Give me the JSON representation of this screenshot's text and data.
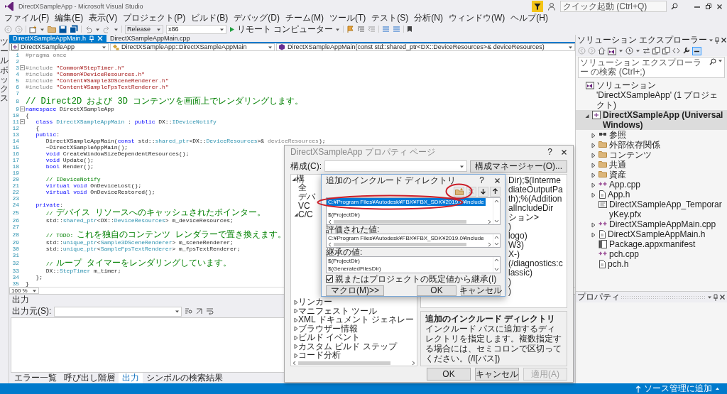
{
  "window": {
    "title": "DirectXSampleApp - Microsoft Visual Studio",
    "quick_launch": {
      "placeholder": "クイック起動 (Ctrl+Q)"
    }
  },
  "menu": [
    "ファイル(F)",
    "編集(E)",
    "表示(V)",
    "プロジェクト(P)",
    "ビルド(B)",
    "デバッグ(D)",
    "チーム(M)",
    "ツール(T)",
    "テスト(S)",
    "分析(N)",
    "ウィンドウ(W)",
    "ヘルプ(H)"
  ],
  "toolbar": {
    "configuration": "Release",
    "platform": "x86",
    "run_target": "リモート コンピューター"
  },
  "toolbox_tab": "ツールボックス",
  "editor": {
    "tabs": [
      {
        "label": "DirectXSampleAppMain.h",
        "selected": true
      },
      {
        "label": "DirectXSampleAppMain.cpp",
        "selected": false
      }
    ],
    "nav": [
      "DirectXSampleApp",
      "DirectXSampleApp::DirectXSampleAppMain",
      "DirectXSampleAppMain(const std::shared_ptr<DX::DeviceResources>& deviceResources)"
    ],
    "lines": [
      {
        "n": "1",
        "fold": false,
        "code": [
          {
            "kind": "pp",
            "text": "#pragma once"
          }
        ]
      },
      {
        "n": "2",
        "fold": false
      },
      {
        "n": "3",
        "fold": true,
        "code": [
          {
            "kind": "pp",
            "text": "#include "
          },
          {
            "kind": "str",
            "text": "\"Common¥StepTimer.h\""
          }
        ]
      },
      {
        "n": "4",
        "fold": false,
        "code": [
          {
            "kind": "pp",
            "text": "#include "
          },
          {
            "kind": "str",
            "text": "\"Common¥DeviceResources.h\""
          }
        ]
      },
      {
        "n": "5",
        "fold": false,
        "code": [
          {
            "kind": "pp",
            "text": "#include "
          },
          {
            "kind": "str",
            "text": "\"Content¥Sample3DSceneRenderer.h\""
          }
        ]
      },
      {
        "n": "6",
        "fold": false,
        "code": [
          {
            "kind": "pp",
            "text": "#include "
          },
          {
            "kind": "str",
            "text": "\"Content¥SampleFpsTextRenderer.h\""
          }
        ]
      },
      {
        "n": "7",
        "fold": false
      },
      {
        "n": "8",
        "fold": false,
        "code": [
          {
            "kind": "jp",
            "text": "// Direct2D および 3D コンテンツを画面上でレンダリングします。"
          }
        ]
      },
      {
        "n": "9",
        "fold": true,
        "code": [
          {
            "kind": "kw",
            "text": "namespace"
          },
          {
            "kind": "p",
            "text": " DirectXSampleApp"
          }
        ]
      },
      {
        "n": "10",
        "fold": false,
        "code": [
          {
            "kind": "p",
            "text": "{"
          }
        ]
      },
      {
        "n": "11",
        "fold": true,
        "code": [
          {
            "kind": "kw",
            "text": "   class"
          },
          {
            "kind": "ty",
            "text": " DirectXSampleAppMain"
          },
          {
            "kind": "p",
            "text": " : "
          },
          {
            "kind": "kw",
            "text": "public"
          },
          {
            "kind": "p",
            "text": " DX::"
          },
          {
            "kind": "ty",
            "text": "IDeviceNotify"
          }
        ]
      },
      {
        "n": "12",
        "fold": false,
        "code": [
          {
            "kind": "p",
            "text": "   {"
          }
        ]
      },
      {
        "n": "13",
        "fold": false,
        "code": [
          {
            "kind": "kw",
            "text": "   public"
          },
          {
            "kind": "p",
            "text": ":"
          }
        ]
      },
      {
        "n": "14",
        "fold": false,
        "code": [
          {
            "kind": "p",
            "text": "      DirectXSampleAppMain("
          },
          {
            "kind": "kw",
            "text": "const"
          },
          {
            "kind": "p",
            "text": " std::"
          },
          {
            "kind": "ty",
            "text": "shared_ptr"
          },
          {
            "kind": "p",
            "text": "<DX::"
          },
          {
            "kind": "ty",
            "text": "DeviceResources"
          },
          {
            "kind": "p",
            "text": ">& "
          },
          {
            "kind": "pa",
            "text": "deviceResources"
          },
          {
            "kind": "p",
            "text": ");"
          }
        ]
      },
      {
        "n": "15",
        "fold": false,
        "code": [
          {
            "kind": "p",
            "text": "      ~DirectXSampleAppMain();"
          }
        ]
      },
      {
        "n": "16",
        "fold": false,
        "code": [
          {
            "kind": "kw",
            "text": "      void"
          },
          {
            "kind": "p",
            "text": " CreateWindowSizeDependentResources();"
          }
        ]
      },
      {
        "n": "17",
        "fold": false,
        "code": [
          {
            "kind": "kw",
            "text": "      void"
          },
          {
            "kind": "p",
            "text": " Update();"
          }
        ]
      },
      {
        "n": "18",
        "fold": false,
        "code": [
          {
            "kind": "kw",
            "text": "      bool"
          },
          {
            "kind": "p",
            "text": " Render();"
          }
        ]
      },
      {
        "n": "19",
        "fold": false
      },
      {
        "n": "20",
        "fold": false,
        "code": [
          {
            "kind": "cm",
            "text": "      // IDeviceNotify"
          }
        ]
      },
      {
        "n": "21",
        "fold": false,
        "code": [
          {
            "kind": "kw",
            "text": "      virtual void"
          },
          {
            "kind": "p",
            "text": " OnDeviceLost();"
          }
        ]
      },
      {
        "n": "22",
        "fold": false,
        "code": [
          {
            "kind": "kw",
            "text": "      virtual void"
          },
          {
            "kind": "p",
            "text": " OnDeviceRestored();"
          }
        ]
      },
      {
        "n": "23",
        "fold": false
      },
      {
        "n": "24",
        "fold": false,
        "code": [
          {
            "kind": "kw",
            "text": "   private"
          },
          {
            "kind": "p",
            "text": ":"
          }
        ]
      },
      {
        "n": "25",
        "fold": false,
        "code": [
          {
            "kind": "cm",
            "text": "      // "
          },
          {
            "kind": "jp",
            "text": "デバイス リソースへのキャッシュされたポインター。"
          }
        ]
      },
      {
        "n": "26",
        "fold": false,
        "code": [
          {
            "kind": "p",
            "text": "      std::"
          },
          {
            "kind": "ty",
            "text": "shared_ptr"
          },
          {
            "kind": "p",
            "text": "<DX::"
          },
          {
            "kind": "ty",
            "text": "DeviceResources"
          },
          {
            "kind": "p",
            "text": "> m_deviceResources;"
          }
        ]
      },
      {
        "n": "27",
        "fold": false
      },
      {
        "n": "28",
        "fold": false,
        "code": [
          {
            "kind": "cm",
            "text": "      // TODO: "
          },
          {
            "kind": "jp",
            "text": "これを独自のコンテンツ レンダラーで置き換えます。"
          }
        ]
      },
      {
        "n": "29",
        "fold": false,
        "code": [
          {
            "kind": "p",
            "text": "      std::"
          },
          {
            "kind": "ty",
            "text": "unique_ptr"
          },
          {
            "kind": "p",
            "text": "<"
          },
          {
            "kind": "ty",
            "text": "Sample3DSceneRenderer"
          },
          {
            "kind": "p",
            "text": "> m_sceneRenderer;"
          }
        ]
      },
      {
        "n": "30",
        "fold": false,
        "code": [
          {
            "kind": "p",
            "text": "      std::"
          },
          {
            "kind": "ty",
            "text": "unique_ptr"
          },
          {
            "kind": "p",
            "text": "<"
          },
          {
            "kind": "ty",
            "text": "SampleFpsTextRenderer"
          },
          {
            "kind": "p",
            "text": "> m_fpsTextRenderer;"
          }
        ]
      },
      {
        "n": "31",
        "fold": false
      },
      {
        "n": "32",
        "fold": false,
        "code": [
          {
            "kind": "cm",
            "text": "      // "
          },
          {
            "kind": "jp",
            "text": "ループ タイマーをレンダリングしています。"
          }
        ]
      },
      {
        "n": "33",
        "fold": false,
        "code": [
          {
            "kind": "p",
            "text": "      DX::"
          },
          {
            "kind": "ty",
            "text": "StepTimer"
          },
          {
            "kind": "p",
            "text": " m_timer;"
          }
        ]
      },
      {
        "n": "34",
        "fold": false,
        "code": [
          {
            "kind": "p",
            "text": "   };"
          }
        ]
      },
      {
        "n": "35",
        "fold": false,
        "code": [
          {
            "kind": "p",
            "text": "}"
          }
        ]
      }
    ],
    "zoom": "100 %"
  },
  "output": {
    "title": "出力",
    "source_label": "出力元(S):"
  },
  "bottom_tabs": [
    {
      "label": "エラー一覧",
      "selected": false
    },
    {
      "label": "呼び出し階層",
      "selected": false
    },
    {
      "label": "出力",
      "selected": true
    },
    {
      "label": "シンボルの検索結果",
      "selected": false
    }
  ],
  "solution_explorer": {
    "title": "ソリューション エクスプローラー",
    "search": {
      "placeholder": "ソリューション エクスプローラー の検索 (Ctrl+;)"
    },
    "tree": [
      {
        "label": "ソリューション 'DirectXSampleApp' (1 プロジェクト)",
        "kind": "solution",
        "expandable": false,
        "selected": false,
        "children": [
          {
            "label": "DirectXSampleApp (Universal Windows)",
            "kind": "project",
            "expandable": true,
            "expanded": true,
            "selected": true,
            "children": [
              {
                "label": "参照",
                "kind": "references",
                "expandable": true,
                "expanded": false,
                "selected": false
              },
              {
                "label": "外部依存関係",
                "kind": "folder",
                "expandable": true,
                "expanded": false,
                "selected": false
              },
              {
                "label": "コンテンツ",
                "kind": "folder",
                "expandable": true,
                "expanded": false,
                "selected": false
              },
              {
                "label": "共通",
                "kind": "folder",
                "expandable": true,
                "expanded": false,
                "selected": false
              },
              {
                "label": "資産",
                "kind": "folder",
                "expandable": true,
                "expanded": false,
                "selected": false
              },
              {
                "label": "App.cpp",
                "kind": "cpp",
                "expandable": true,
                "expanded": false,
                "selected": false
              },
              {
                "label": "App.h",
                "kind": "header",
                "expandable": true,
                "expanded": false,
                "selected": false
              },
              {
                "label": "DirectXSampleApp_TemporaryKey.pfx",
                "kind": "key",
                "expandable": false,
                "selected": false
              },
              {
                "label": "DirectXSampleAppMain.cpp",
                "kind": "cpp",
                "expandable": true,
                "expanded": false,
                "selected": false
              },
              {
                "label": "DirectXSampleAppMain.h",
                "kind": "header",
                "expandable": true,
                "expanded": false,
                "selected": false
              },
              {
                "label": "Package.appxmanifest",
                "kind": "manifest",
                "expandable": false,
                "selected": false
              },
              {
                "label": "pch.cpp",
                "kind": "cpp",
                "expandable": false,
                "selected": false
              },
              {
                "label": "pch.h",
                "kind": "header",
                "expandable": false,
                "selected": false
              }
            ]
          }
        ]
      }
    ]
  },
  "properties": {
    "title": "プロパティ"
  },
  "property_pages": {
    "title": "DirectXSampleApp プロパティ ページ",
    "help": "?",
    "config_label": "構成(C):",
    "config_manager": "構成マネージャー(O)...",
    "tree_top": [
      {
        "text": "構",
        "expandable": true,
        "expanded": true,
        "children": [
          {
            "text": "全",
            "expandable": false
          },
          {
            "text": "デバ",
            "expandable": false
          },
          {
            "text": "VC",
            "expandable": false
          },
          {
            "text": "C/C",
            "expandable": true,
            "expanded": true
          }
        ]
      }
    ],
    "tree_bottom": [
      {
        "text": "リンカー",
        "expandable": true,
        "expanded": false
      },
      {
        "text": "マニフェスト ツール",
        "expandable": true,
        "expanded": false
      },
      {
        "text": "XML ドキュメント ジェネレー",
        "expandable": true,
        "expanded": false
      },
      {
        "text": "ブラウザー情報",
        "expandable": true,
        "expanded": false
      },
      {
        "text": "ビルド イベント",
        "expandable": true,
        "expanded": false
      },
      {
        "text": "カスタム ビルド ステップ",
        "expandable": true,
        "expanded": false
      },
      {
        "text": "コード分析",
        "expandable": true,
        "expanded": false
      }
    ],
    "values": [
      {
        "text": "Dir);$(IntermediateOutputPath);%(AdditionalIncludeDir"
      },
      {
        "text": "ション>"
      },
      {
        "text": ")"
      },
      {
        "text": "logo)"
      },
      {
        "text": "W3)"
      },
      {
        "text": "X-)"
      },
      {
        "text": "(/diagnostics:classic)"
      },
      {
        "text": ")"
      },
      {
        "text": ")"
      }
    ],
    "description": {
      "title": "追加のインクルード ディレクトリ",
      "text": "インクルード パスに追加するディレクトリを指定します。複数指定する場合には、セミコロンで区切ってください。(/I[パス])"
    },
    "buttons": [
      {
        "label": "OK",
        "disabled": false
      },
      {
        "label": "キャンセル",
        "disabled": false
      },
      {
        "label": "適用(A)",
        "disabled": true
      }
    ]
  },
  "include_dialog": {
    "title": "追加のインクルード ディレクトリ",
    "help": "?",
    "entries": [
      {
        "text": "C:¥Program Files¥Autodesk¥FBX¥FBX_SDK¥2019.0¥include",
        "selected": true
      },
      {
        "text": "$(ProjectDir)",
        "selected": false
      }
    ],
    "evaluated_label": "評価された値:",
    "evaluated": [
      "C:¥Program Files¥Autodesk¥FBX¥FBX_SDK¥2019.0¥include"
    ],
    "inherited_label": "継承の値:",
    "inherited": [
      "$(ProjectDir)",
      "$(GeneratedFilesDir)"
    ],
    "inherit": {
      "label": "親またはプロジェクトの既定値から継承(I)",
      "checked": true
    },
    "macro_button": "マクロ(M)>>",
    "buttons": [
      "OK",
      "キャンセル"
    ],
    "annotations": {
      "new_button_ring": true,
      "first_entry_ring": true
    }
  },
  "status_bar": {
    "action": "ソース管理に追加"
  }
}
